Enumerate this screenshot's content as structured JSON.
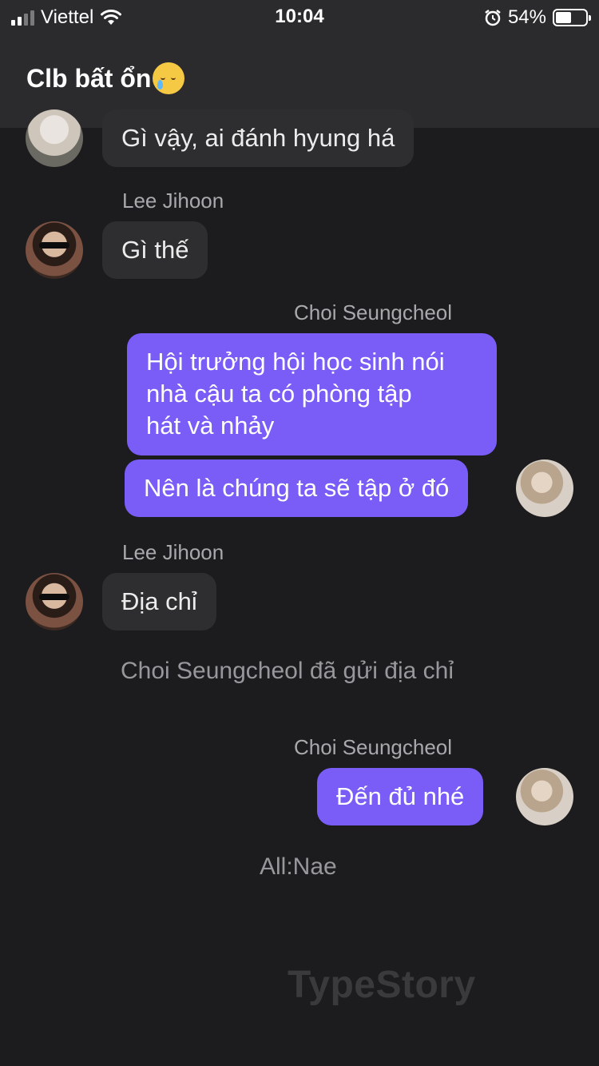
{
  "status_bar": {
    "carrier": "Viettel",
    "time": "10:04",
    "battery_percent": "54%",
    "battery_level": 0.54,
    "icons": [
      "signal-icon",
      "wifi-icon",
      "alarm-icon",
      "battery-icon"
    ]
  },
  "header": {
    "title": "Clb bất ổn",
    "title_emoji": "crying-face-emoji"
  },
  "messages": [
    {
      "sender": "",
      "text": "Gì vậy, ai đánh hyung há",
      "direction": "incoming"
    },
    {
      "sender": "Lee Jihoon",
      "text": "Gì thế",
      "direction": "incoming"
    },
    {
      "sender": "Choi Seungcheol",
      "text_lines": [
        "Hội trưởng hội học sinh nói",
        "nhà cậu ta có phòng tập",
        "hát và nhảy"
      ],
      "direction": "outgoing"
    },
    {
      "sender": "",
      "text": "Nên là chúng ta sẽ tập ở đó",
      "direction": "outgoing"
    },
    {
      "sender": "Lee Jihoon",
      "text": "Địa chỉ",
      "direction": "incoming"
    },
    {
      "system": "Choi Seungcheol đã gửi địa chỉ"
    },
    {
      "sender": "Choi Seungcheol",
      "text": "Đến đủ nhé",
      "direction": "outgoing"
    },
    {
      "system": "All:Nae"
    }
  ],
  "watermark": "TypeStory",
  "colors": {
    "background": "#1c1c1e",
    "header": "#2b2b2d",
    "incoming_bubble": "#2e2e30",
    "outgoing_bubble": "#7a5cf7"
  }
}
